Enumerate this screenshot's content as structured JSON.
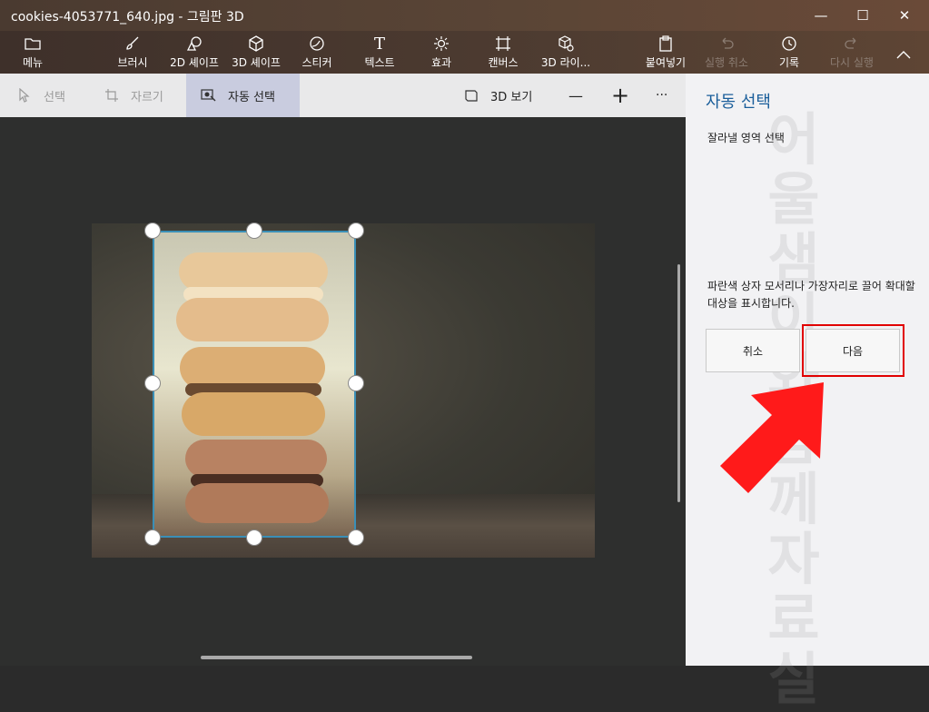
{
  "window": {
    "title": "cookies-4053771_640.jpg - 그림판 3D",
    "minimize": "—",
    "maximize": "☐",
    "close": "✕"
  },
  "ribbon": {
    "menu": "메뉴",
    "brushes": "브러시",
    "shapes2d": "2D 셰이프",
    "shapes3d": "3D 셰이프",
    "stickers": "스티커",
    "text": "텍스트",
    "effects": "효과",
    "canvas": "캔버스",
    "library3d": "3D 라이...",
    "paste": "붙여넣기",
    "undo": "실행 취소",
    "history": "기록",
    "redo": "다시 실행"
  },
  "subbar": {
    "select": "선택",
    "crop": "자르기",
    "magic_select": "자동 선택",
    "view3d": "3D 보기",
    "zoom_out": "—",
    "zoom_in": "+",
    "more": "···"
  },
  "panel": {
    "title": "자동 선택",
    "subtitle": "잘라낼 영역 선택",
    "description": "파란색 상자 모서리나 가장자리로 끌어 확대할 대상을 표시합니다.",
    "cancel": "취소",
    "next": "다음",
    "watermark": "어울샘이와 함께 자료실"
  },
  "colors": {
    "accent": "#1a5e9a",
    "selection": "#3a8fb7",
    "highlight": "#e10000",
    "arrow": "#ff1a1a"
  }
}
